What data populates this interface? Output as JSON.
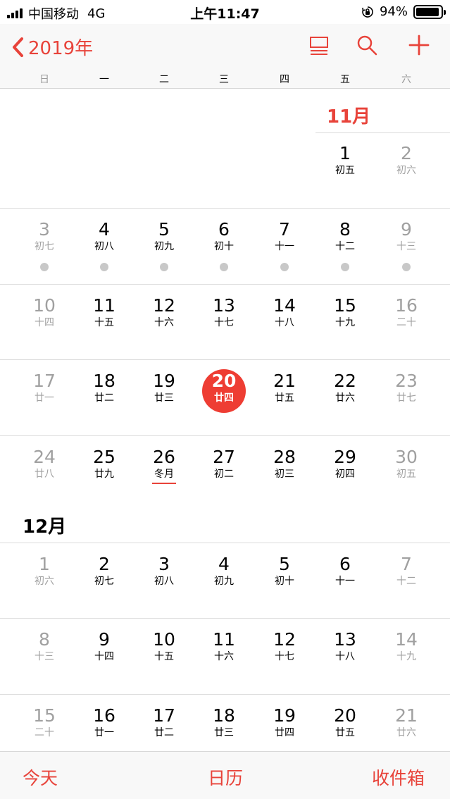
{
  "status_bar": {
    "carrier": "中国移动",
    "network": "4G",
    "time": "上午11:47",
    "battery_percent": "94%",
    "battery_level": 0.94
  },
  "nav": {
    "back_label": "2019年",
    "icons": [
      "chevron-left-icon",
      "list-icon",
      "search-icon",
      "add-icon"
    ],
    "accent_color": "#e8433a"
  },
  "weekdays": [
    "日",
    "一",
    "二",
    "三",
    "四",
    "五",
    "六"
  ],
  "months": [
    {
      "label": "11月",
      "weeks": [
        [
          {
            "d": "",
            "l": ""
          },
          {
            "d": "",
            "l": ""
          },
          {
            "d": "",
            "l": ""
          },
          {
            "d": "",
            "l": ""
          },
          {
            "d": "",
            "l": ""
          },
          {
            "d": "1",
            "l": "初五"
          },
          {
            "d": "2",
            "l": "初六"
          }
        ],
        [
          {
            "d": "3",
            "l": "初七",
            "dot": true
          },
          {
            "d": "4",
            "l": "初八",
            "dot": true
          },
          {
            "d": "5",
            "l": "初九",
            "dot": true
          },
          {
            "d": "6",
            "l": "初十",
            "dot": true
          },
          {
            "d": "7",
            "l": "十一",
            "dot": true
          },
          {
            "d": "8",
            "l": "十二",
            "dot": true
          },
          {
            "d": "9",
            "l": "十三",
            "dot": true
          }
        ],
        [
          {
            "d": "10",
            "l": "十四"
          },
          {
            "d": "11",
            "l": "十五"
          },
          {
            "d": "12",
            "l": "十六"
          },
          {
            "d": "13",
            "l": "十七"
          },
          {
            "d": "14",
            "l": "十八"
          },
          {
            "d": "15",
            "l": "十九"
          },
          {
            "d": "16",
            "l": "二十"
          }
        ],
        [
          {
            "d": "17",
            "l": "廿一"
          },
          {
            "d": "18",
            "l": "廿二"
          },
          {
            "d": "19",
            "l": "廿三"
          },
          {
            "d": "20",
            "l": "廿四",
            "today": true
          },
          {
            "d": "21",
            "l": "廿五"
          },
          {
            "d": "22",
            "l": "廿六"
          },
          {
            "d": "23",
            "l": "廿七"
          }
        ],
        [
          {
            "d": "24",
            "l": "廿八"
          },
          {
            "d": "25",
            "l": "廿九"
          },
          {
            "d": "26",
            "l": "冬月",
            "term": true
          },
          {
            "d": "27",
            "l": "初二"
          },
          {
            "d": "28",
            "l": "初三"
          },
          {
            "d": "29",
            "l": "初四"
          },
          {
            "d": "30",
            "l": "初五"
          }
        ]
      ]
    },
    {
      "label": "12月",
      "weeks": [
        [
          {
            "d": "1",
            "l": "初六"
          },
          {
            "d": "2",
            "l": "初七"
          },
          {
            "d": "3",
            "l": "初八"
          },
          {
            "d": "4",
            "l": "初九"
          },
          {
            "d": "5",
            "l": "初十"
          },
          {
            "d": "6",
            "l": "十一"
          },
          {
            "d": "7",
            "l": "十二"
          }
        ],
        [
          {
            "d": "8",
            "l": "十三"
          },
          {
            "d": "9",
            "l": "十四"
          },
          {
            "d": "10",
            "l": "十五"
          },
          {
            "d": "11",
            "l": "十六"
          },
          {
            "d": "12",
            "l": "十七"
          },
          {
            "d": "13",
            "l": "十八"
          },
          {
            "d": "14",
            "l": "十九"
          }
        ],
        [
          {
            "d": "15",
            "l": "二十"
          },
          {
            "d": "16",
            "l": "廿一"
          },
          {
            "d": "17",
            "l": "廿二"
          },
          {
            "d": "18",
            "l": "廿三"
          },
          {
            "d": "19",
            "l": "廿四"
          },
          {
            "d": "20",
            "l": "廿五"
          },
          {
            "d": "21",
            "l": "廿六"
          }
        ]
      ]
    }
  ],
  "tab_bar": {
    "today_label": "今天",
    "calendars_label": "日历",
    "inbox_label": "收件箱"
  }
}
